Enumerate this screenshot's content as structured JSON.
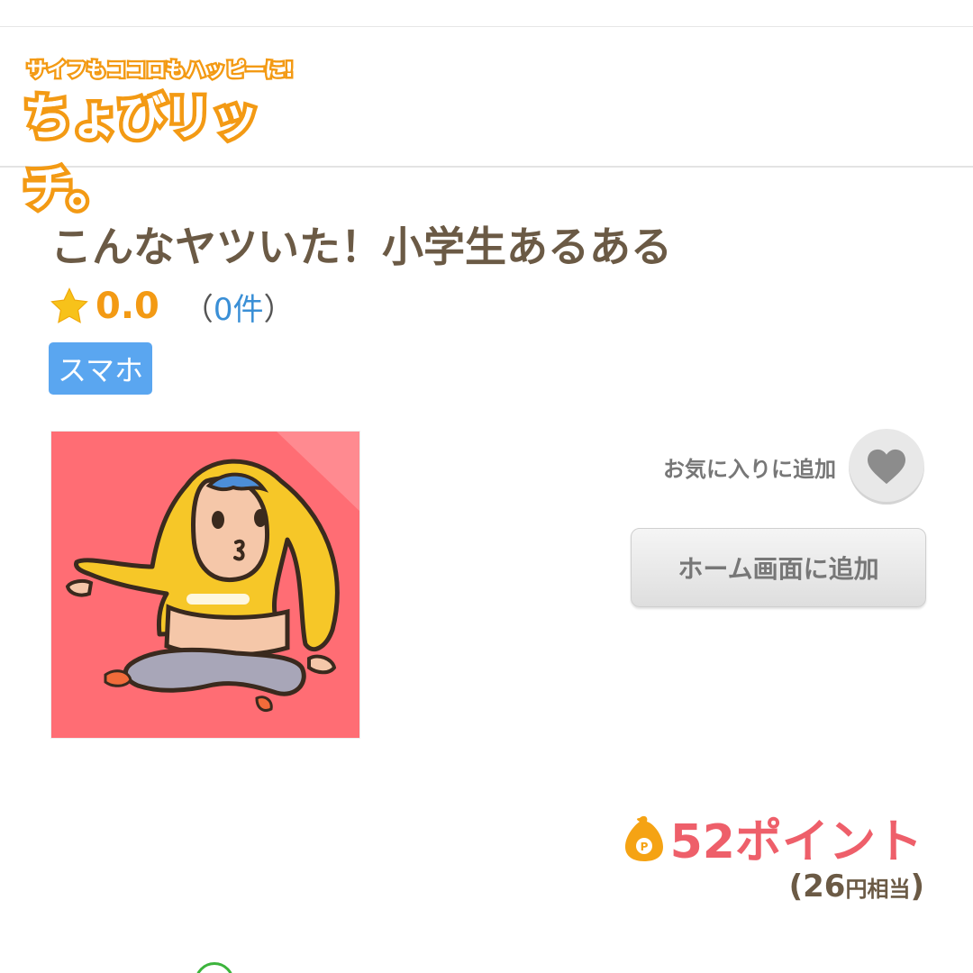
{
  "header": {
    "logo_tagline": "サイフもココロもハッピーに!",
    "logo_brand": "ちょびリッチ。"
  },
  "app": {
    "title": "こんなヤツいた！小学生あるある",
    "rating_score": "0.0",
    "rating_count_open": "（",
    "rating_count_num": "0件",
    "rating_count_close": "）",
    "platform_badge": "スマホ"
  },
  "actions": {
    "favorite_label": "お気に入りに追加",
    "home_screen_label": "ホーム画面に追加"
  },
  "reward": {
    "points_text": "52ポイント",
    "yen_open": "(",
    "yen_value": "26",
    "yen_unit": "円相当",
    "yen_close": ")"
  },
  "icons": {
    "star": "star-icon",
    "heart": "heart-icon",
    "points": "point-bag-icon"
  },
  "colors": {
    "accent_orange": "#f39a14",
    "points_red": "#ee5f6a",
    "badge_blue": "#5aa6f0",
    "link_blue": "#3a8fd6",
    "title_brown": "#6b5a45"
  }
}
